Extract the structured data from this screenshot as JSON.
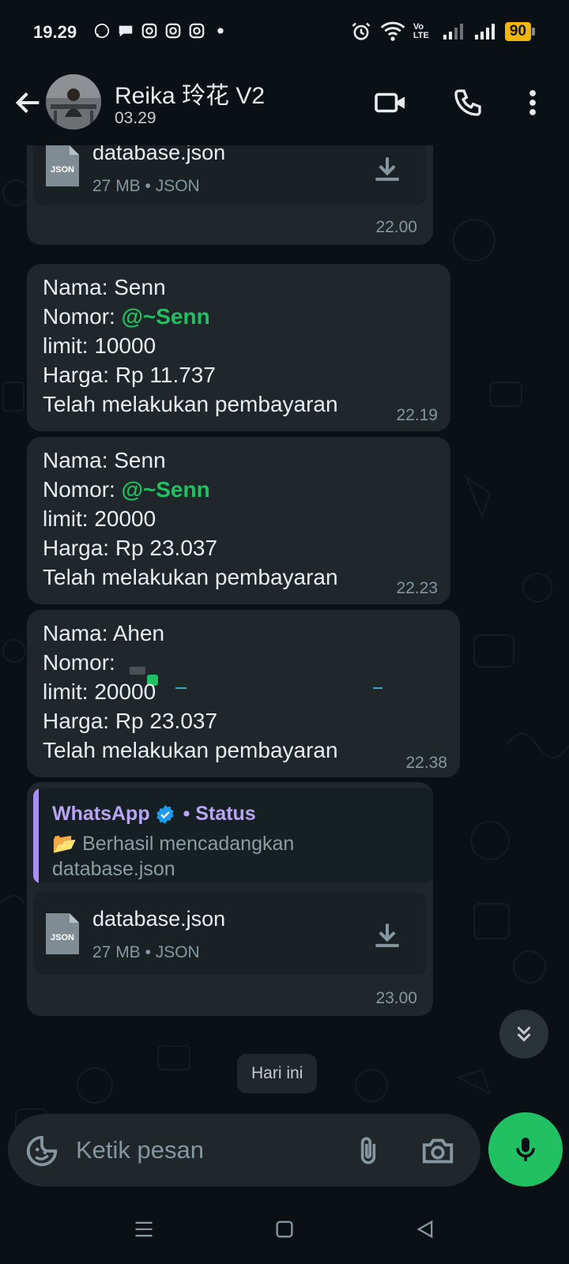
{
  "status_bar": {
    "time": "19.29",
    "battery": "90",
    "left_icons": [
      "whatsapp-icon",
      "chat-icon",
      "instagram-icon",
      "instagram-icon",
      "instagram-icon",
      "dot-icon"
    ],
    "right_icons": [
      "alarm-icon",
      "wifi-icon",
      "volte-icon",
      "signal-icon",
      "signal-icon"
    ],
    "volte_label": "Vo LTE"
  },
  "header": {
    "title": "Reika 玲花 V2",
    "subtitle": "03.29"
  },
  "messages": [
    {
      "type": "document",
      "file_name": "database.json",
      "meta": "27 MB • JSON",
      "icon_label": "JSON",
      "time": "22.00"
    },
    {
      "type": "text",
      "lines": {
        "nama": "Nama: Senn",
        "nomor_prefix": "Nomor: ",
        "mention": "@~Senn",
        "limit": "limit: 10000",
        "harga": "Harga: Rp 11.737",
        "status": "Telah melakukan pembayaran"
      },
      "time": "22.19"
    },
    {
      "type": "text",
      "lines": {
        "nama": "Nama: Senn",
        "nomor_prefix": "Nomor: ",
        "mention": "@~Senn",
        "limit": "limit: 20000",
        "harga": "Harga: Rp 23.037",
        "status": "Telah melakukan pembayaran"
      },
      "time": "22.23"
    },
    {
      "type": "text",
      "lines": {
        "nama": "Nama: Ahen",
        "nomor_prefix": "Nomor: ",
        "limit": "limit: 20000",
        "harga": "Harga: Rp 23.037",
        "status": "Telah melakukan pembayaran"
      },
      "time": "22.38"
    },
    {
      "type": "quoted_document",
      "quote": {
        "sender": "WhatsApp",
        "suffix": "• Status",
        "text_line1": "📂 Berhasil mencadangkan",
        "text_line2": "database.json"
      },
      "file_name": "database.json",
      "meta": "27 MB • JSON",
      "icon_label": "JSON",
      "time": "23.00"
    }
  ],
  "date_chip": "Hari ini",
  "composer": {
    "placeholder": "Ketik pesan"
  },
  "colors": {
    "background": "#0b1014",
    "bubble": "#1f272a",
    "mention": "#21c063",
    "quote_bar": "#a88ff0",
    "mic": "#21c063",
    "battery": "#f2b600"
  }
}
